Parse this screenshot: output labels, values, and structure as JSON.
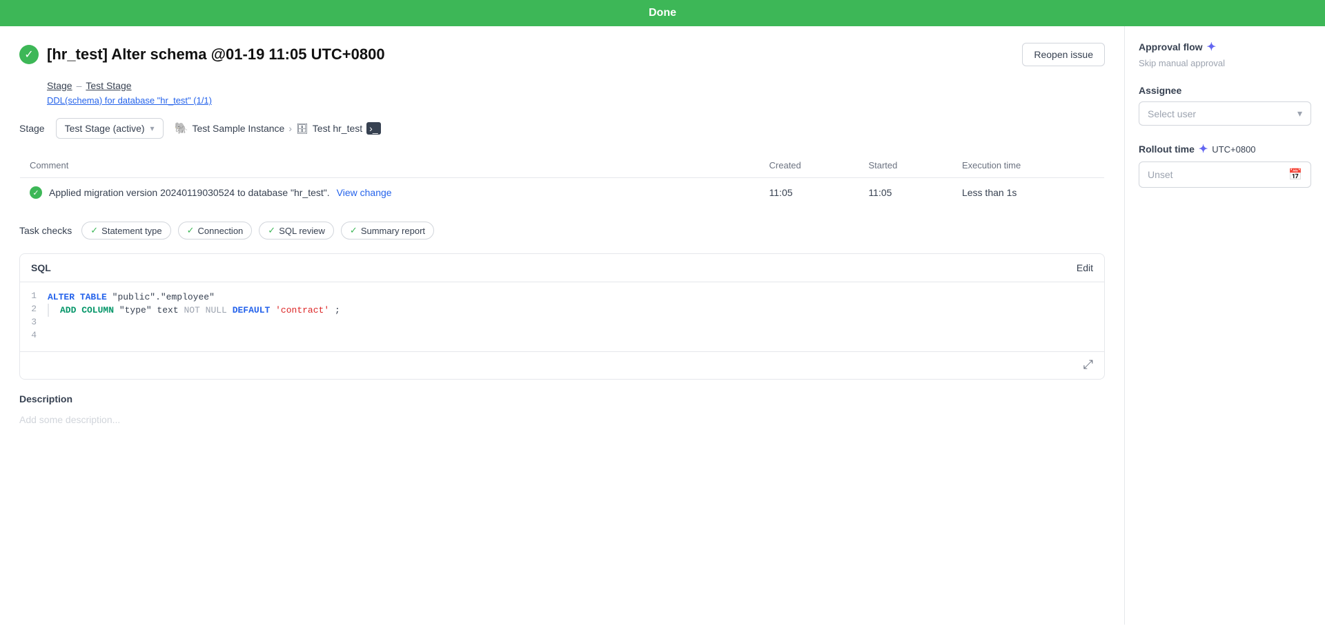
{
  "topbar": {
    "label": "Done"
  },
  "header": {
    "title": "[hr_test] Alter schema @01-19 11:05 UTC+0800",
    "reopen_label": "Reopen issue",
    "stage_link": "Stage",
    "separator": "–",
    "stage_name_link": "Test Stage",
    "ddl_info": "DDL(schema) for database \"hr_test\" (1/1)"
  },
  "stage_row": {
    "label": "Stage",
    "stage_value": "Test Stage (active)",
    "instance_name": "Test Sample Instance",
    "db_name": "Test hr_test"
  },
  "table": {
    "columns": [
      "Comment",
      "Created",
      "Started",
      "Execution time"
    ],
    "rows": [
      {
        "comment_prefix": "Applied migration version 20240119030524 to database \"hr_test\".",
        "view_change_label": "View change",
        "created": "11:05",
        "started": "11:05",
        "execution_time": "Less than 1s"
      }
    ]
  },
  "task_checks": {
    "label": "Task checks",
    "items": [
      {
        "label": "Statement type"
      },
      {
        "label": "Connection"
      },
      {
        "label": "SQL review"
      },
      {
        "label": "Summary report"
      }
    ]
  },
  "sql": {
    "title": "SQL",
    "edit_label": "Edit",
    "lines": [
      {
        "num": "1",
        "has_pipe": false,
        "tokens": [
          {
            "type": "kw-blue",
            "text": "ALTER"
          },
          {
            "type": "plain",
            "text": " "
          },
          {
            "type": "kw-blue",
            "text": "TABLE"
          },
          {
            "type": "plain",
            "text": " "
          },
          {
            "type": "plain",
            "text": "\"public\".\"employee\""
          }
        ]
      },
      {
        "num": "2",
        "has_pipe": true,
        "tokens": [
          {
            "type": "kw-green",
            "text": "    ADD COLUMN"
          },
          {
            "type": "plain",
            "text": " "
          },
          {
            "type": "plain",
            "text": "\"type\""
          },
          {
            "type": "plain",
            "text": " text "
          },
          {
            "type": "kw-gray",
            "text": "NOT NULL"
          },
          {
            "type": "plain",
            "text": " "
          },
          {
            "type": "kw-blue",
            "text": "DEFAULT"
          },
          {
            "type": "plain",
            "text": " "
          },
          {
            "type": "str-red",
            "text": "'contract'"
          },
          {
            "type": "plain",
            "text": ";"
          }
        ]
      },
      {
        "num": "3",
        "has_pipe": false,
        "tokens": []
      },
      {
        "num": "4",
        "has_pipe": false,
        "tokens": []
      }
    ]
  },
  "description": {
    "title": "Description",
    "placeholder": "Add some description..."
  },
  "sidebar": {
    "approval_title": "Approval flow",
    "approval_subtitle": "Skip manual approval",
    "assignee_label": "Assignee",
    "select_user_placeholder": "Select user",
    "rollout_label": "Rollout time",
    "timezone": "UTC+0800",
    "unset_placeholder": "Unset"
  }
}
